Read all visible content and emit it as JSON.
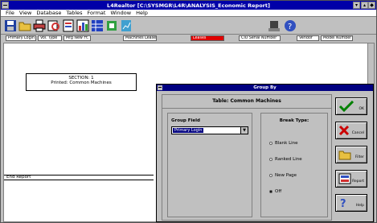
{
  "window": {
    "title": "L4Realtor [C:\\SYSMGR\\L4R\\ANALYSIS_Economic Report]"
  },
  "menu": {
    "items": [
      "File",
      "View",
      "Database",
      "Tables",
      "Format",
      "Window",
      "Help"
    ]
  },
  "toolbar": {
    "icons": [
      "save-icon",
      "folder-icon",
      "print-icon",
      "preview-icon",
      "report-icon",
      "chart-icon",
      "table-icon",
      "database-icon",
      "graph-icon",
      "sort-icon",
      "filter-icon",
      "help-icon"
    ]
  },
  "tabs": [
    {
      "label": "Primary Login",
      "active": false
    },
    {
      "label": "Vol. Type",
      "active": false
    },
    {
      "label": "Mfg New Ft.",
      "active": false
    },
    {
      "label": "Machines Leases",
      "active": false
    },
    {
      "label": "Leases",
      "active": true
    },
    {
      "label": "CIU Serial Number",
      "active": false
    },
    {
      "label": "Vendor",
      "active": false
    },
    {
      "label": "Model Number",
      "active": false
    }
  ],
  "report": {
    "group_header_line1": "SECTION: 1",
    "group_header_line2": "Printed: Common Machines",
    "end_report": "End Report"
  },
  "dialog": {
    "title": "Group By",
    "heading": "Table: Common Machines",
    "group_field_label": "Group Field",
    "group_field_value": "Primary Login",
    "break_label": "Break Type:",
    "break_options": [
      "Blank Line",
      "Ranked Line",
      "New Page",
      "Off"
    ],
    "selected_break": "Off",
    "buttons": {
      "ok": "OK",
      "cancel": "Cancel",
      "filter": "Filter",
      "report": "Report",
      "help": "Help"
    }
  },
  "colors": {
    "titlebar": "#0000a8",
    "active_tab": "#e00000",
    "ok_check": "#008000",
    "cancel_x": "#cc0000"
  }
}
